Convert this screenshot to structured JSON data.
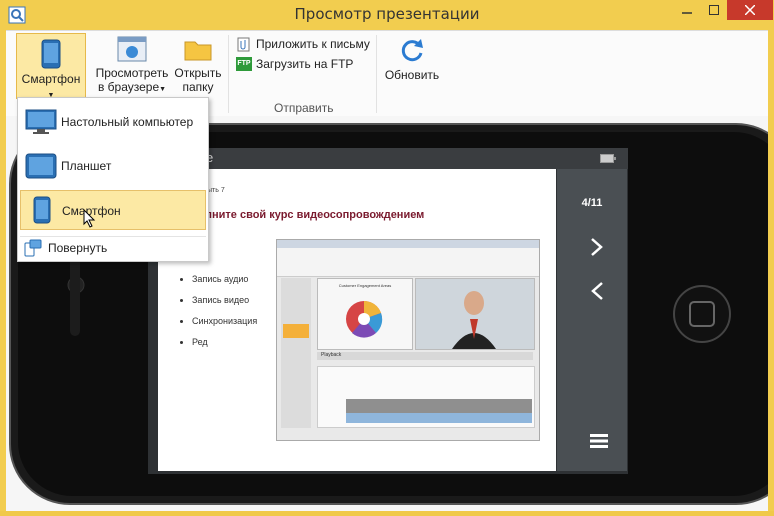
{
  "window": {
    "title": "Просмотр презентации"
  },
  "ribbon": {
    "smartphone_label": "Смартфон",
    "browser_label_1": "Просмотреть",
    "browser_label_2": "в браузере",
    "folder_label_1": "Открыть",
    "folder_label_2": "папку",
    "email_label": "Приложить к письму",
    "ftp_label": "Загрузить на FTP",
    "ftp_badge": "FTP",
    "send_group": "Отправить",
    "refresh_label": "Обновить"
  },
  "dropdown": {
    "items": [
      {
        "label": "Настольный компьютер"
      },
      {
        "label": "Планшет"
      },
      {
        "label": "Смартфон"
      }
    ],
    "rotate_label": "Повернуть"
  },
  "phone": {
    "header_fragment": "e",
    "slide_counter": "4/11",
    "slide_meta": "ыть 7",
    "slide_title": "лните свой курс видеосопровождением",
    "bullets": [
      "Запись аудио",
      "Запись видео",
      "Синхронизация",
      "Ред"
    ],
    "screenshot_caption": "Customer Engagement Areas",
    "playback_label": "Playback"
  },
  "colors": {
    "accent": "#f2cd4f",
    "close": "#c7392b",
    "selected": "#fce9a4",
    "slide_title": "#7a1a2e"
  }
}
